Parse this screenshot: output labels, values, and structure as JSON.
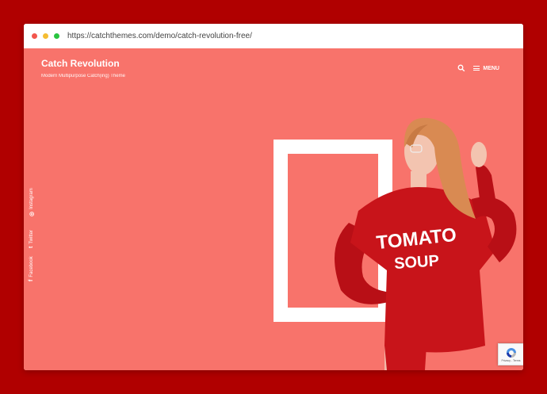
{
  "browser": {
    "url": "https://catchthemes.com/demo/catch-revolution-free/",
    "dot_colors": [
      "#f2564d",
      "#f5bd33",
      "#29c440"
    ]
  },
  "site": {
    "title": "Catch Revolution",
    "tagline": "Modern Multipurpose Catch(ing) Theme",
    "background_color": "#f8736b"
  },
  "nav": {
    "search_icon": "search-icon",
    "menu_label": "MENU"
  },
  "social": [
    {
      "label": "Facebook",
      "icon": "facebook-icon",
      "glyph": "f"
    },
    {
      "label": "Twitter",
      "icon": "twitter-icon",
      "glyph": "t"
    },
    {
      "label": "Instagram",
      "icon": "instagram-icon",
      "glyph": "◎"
    }
  ],
  "hero": {
    "shirt_line1": "TOMATO",
    "shirt_line2": "SOUP",
    "shirt_color": "#c8141a"
  },
  "recaptcha": {
    "label": "Privacy - Terms"
  }
}
